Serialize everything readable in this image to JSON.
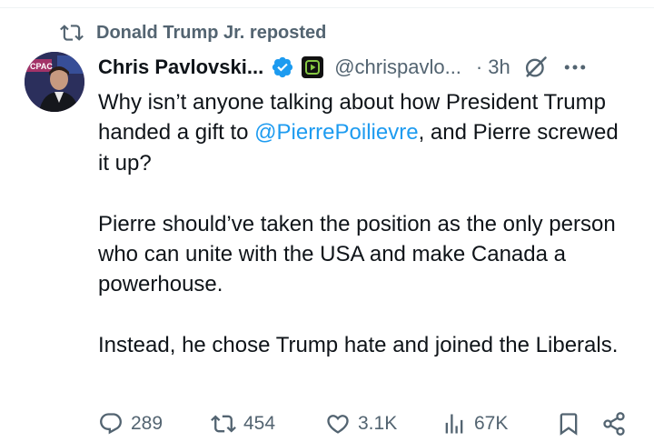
{
  "repost": {
    "text": "Donald Trump Jr. reposted",
    "icon": "repost-icon"
  },
  "author": {
    "name": "Chris Pavlovski...",
    "handle": "@chrispavlo...",
    "separator": "·",
    "time": "3h",
    "avatar": "avatar",
    "verified_icon": "verified-badge-icon",
    "affiliate_icon": "rumble-badge-icon"
  },
  "tweet": {
    "para1_start": "Why isn’t anyone talking about how President Trump handed a gift to ",
    "mention": "@PierrePoilievre",
    "para1_end": ", and Pierre screwed it up?",
    "para2": "Pierre should’ve taken the position as the only person who can unite with the USA and make Canada a powerhouse.",
    "para3": "Instead, he chose Trump hate and joined the Liberals."
  },
  "actions": {
    "replies": "289",
    "reposts": "454",
    "likes": "3.1K",
    "views": "67K"
  },
  "colors": {
    "text": "#0f1419",
    "muted": "#536471",
    "link": "#1d9bf0",
    "verified": "#1d9bf0",
    "affiliate_green": "#85c742"
  }
}
